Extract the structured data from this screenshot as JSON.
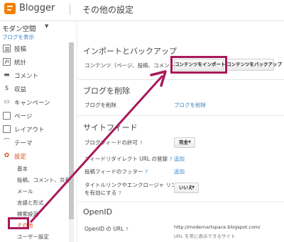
{
  "header": {
    "logo_text": "Blogger",
    "page_title": "その他の設定"
  },
  "sidebar": {
    "blog_name": "モダン空間",
    "view_blog_label": "ブログを表示",
    "items": [
      {
        "label": "投稿",
        "icon": "posts-icon"
      },
      {
        "label": "統計",
        "icon": "stats-icon"
      },
      {
        "label": "コメント",
        "icon": "comment-icon"
      },
      {
        "label": "収益",
        "icon": "earnings-icon"
      },
      {
        "label": "キャンペーン",
        "icon": "campaign-icon"
      },
      {
        "label": "ページ",
        "icon": "pages-icon"
      },
      {
        "label": "レイアウト",
        "icon": "layout-icon"
      },
      {
        "label": "テーマ",
        "icon": "theme-icon"
      },
      {
        "label": "設定",
        "icon": "gear-icon"
      }
    ],
    "sub_items": [
      {
        "label": "基本"
      },
      {
        "label": "投稿、コメント、共有"
      },
      {
        "label": "メール"
      },
      {
        "label": "言語と形式"
      },
      {
        "label": "検索設定"
      },
      {
        "label": "その他"
      },
      {
        "label": "ユーザー設定"
      }
    ]
  },
  "import_backup": {
    "title": "インポートとバックアップ",
    "content_label": "コンテンツ（ページ、投稿、コメント）",
    "import_button": "コンテンツをインポート",
    "backup_button": "コンテンツをバックアップ"
  },
  "delete_blog": {
    "title": "ブログを削除",
    "row_label": "ブログを削除",
    "link_label": "ブログを削除"
  },
  "site_feed": {
    "title": "サイトフィード",
    "feed_allow_label": "ブログフィードの許可",
    "feed_allow_value": "完全",
    "redirect_label": "フィードリダイレクト URL の登録",
    "redirect_link": "追加",
    "post_feed_footer_label": "投稿フィードのフッター",
    "post_feed_footer_link": "追加",
    "title_link_label_1": "タイトルリンクやエンクロージャ リンク",
    "title_link_label_2": "を有効にする",
    "title_link_value": "いいえ"
  },
  "openid": {
    "title": "OpenID",
    "url_label": "OpenID の URL",
    "url_value": "http://modernartspace.blogspot.com/",
    "url_note": "URL を常に表示できるサイト"
  },
  "colors": {
    "accent": "#d94f1e",
    "link": "#3d85c6",
    "annotation": "#a8195a",
    "brand": "#f57d00"
  }
}
